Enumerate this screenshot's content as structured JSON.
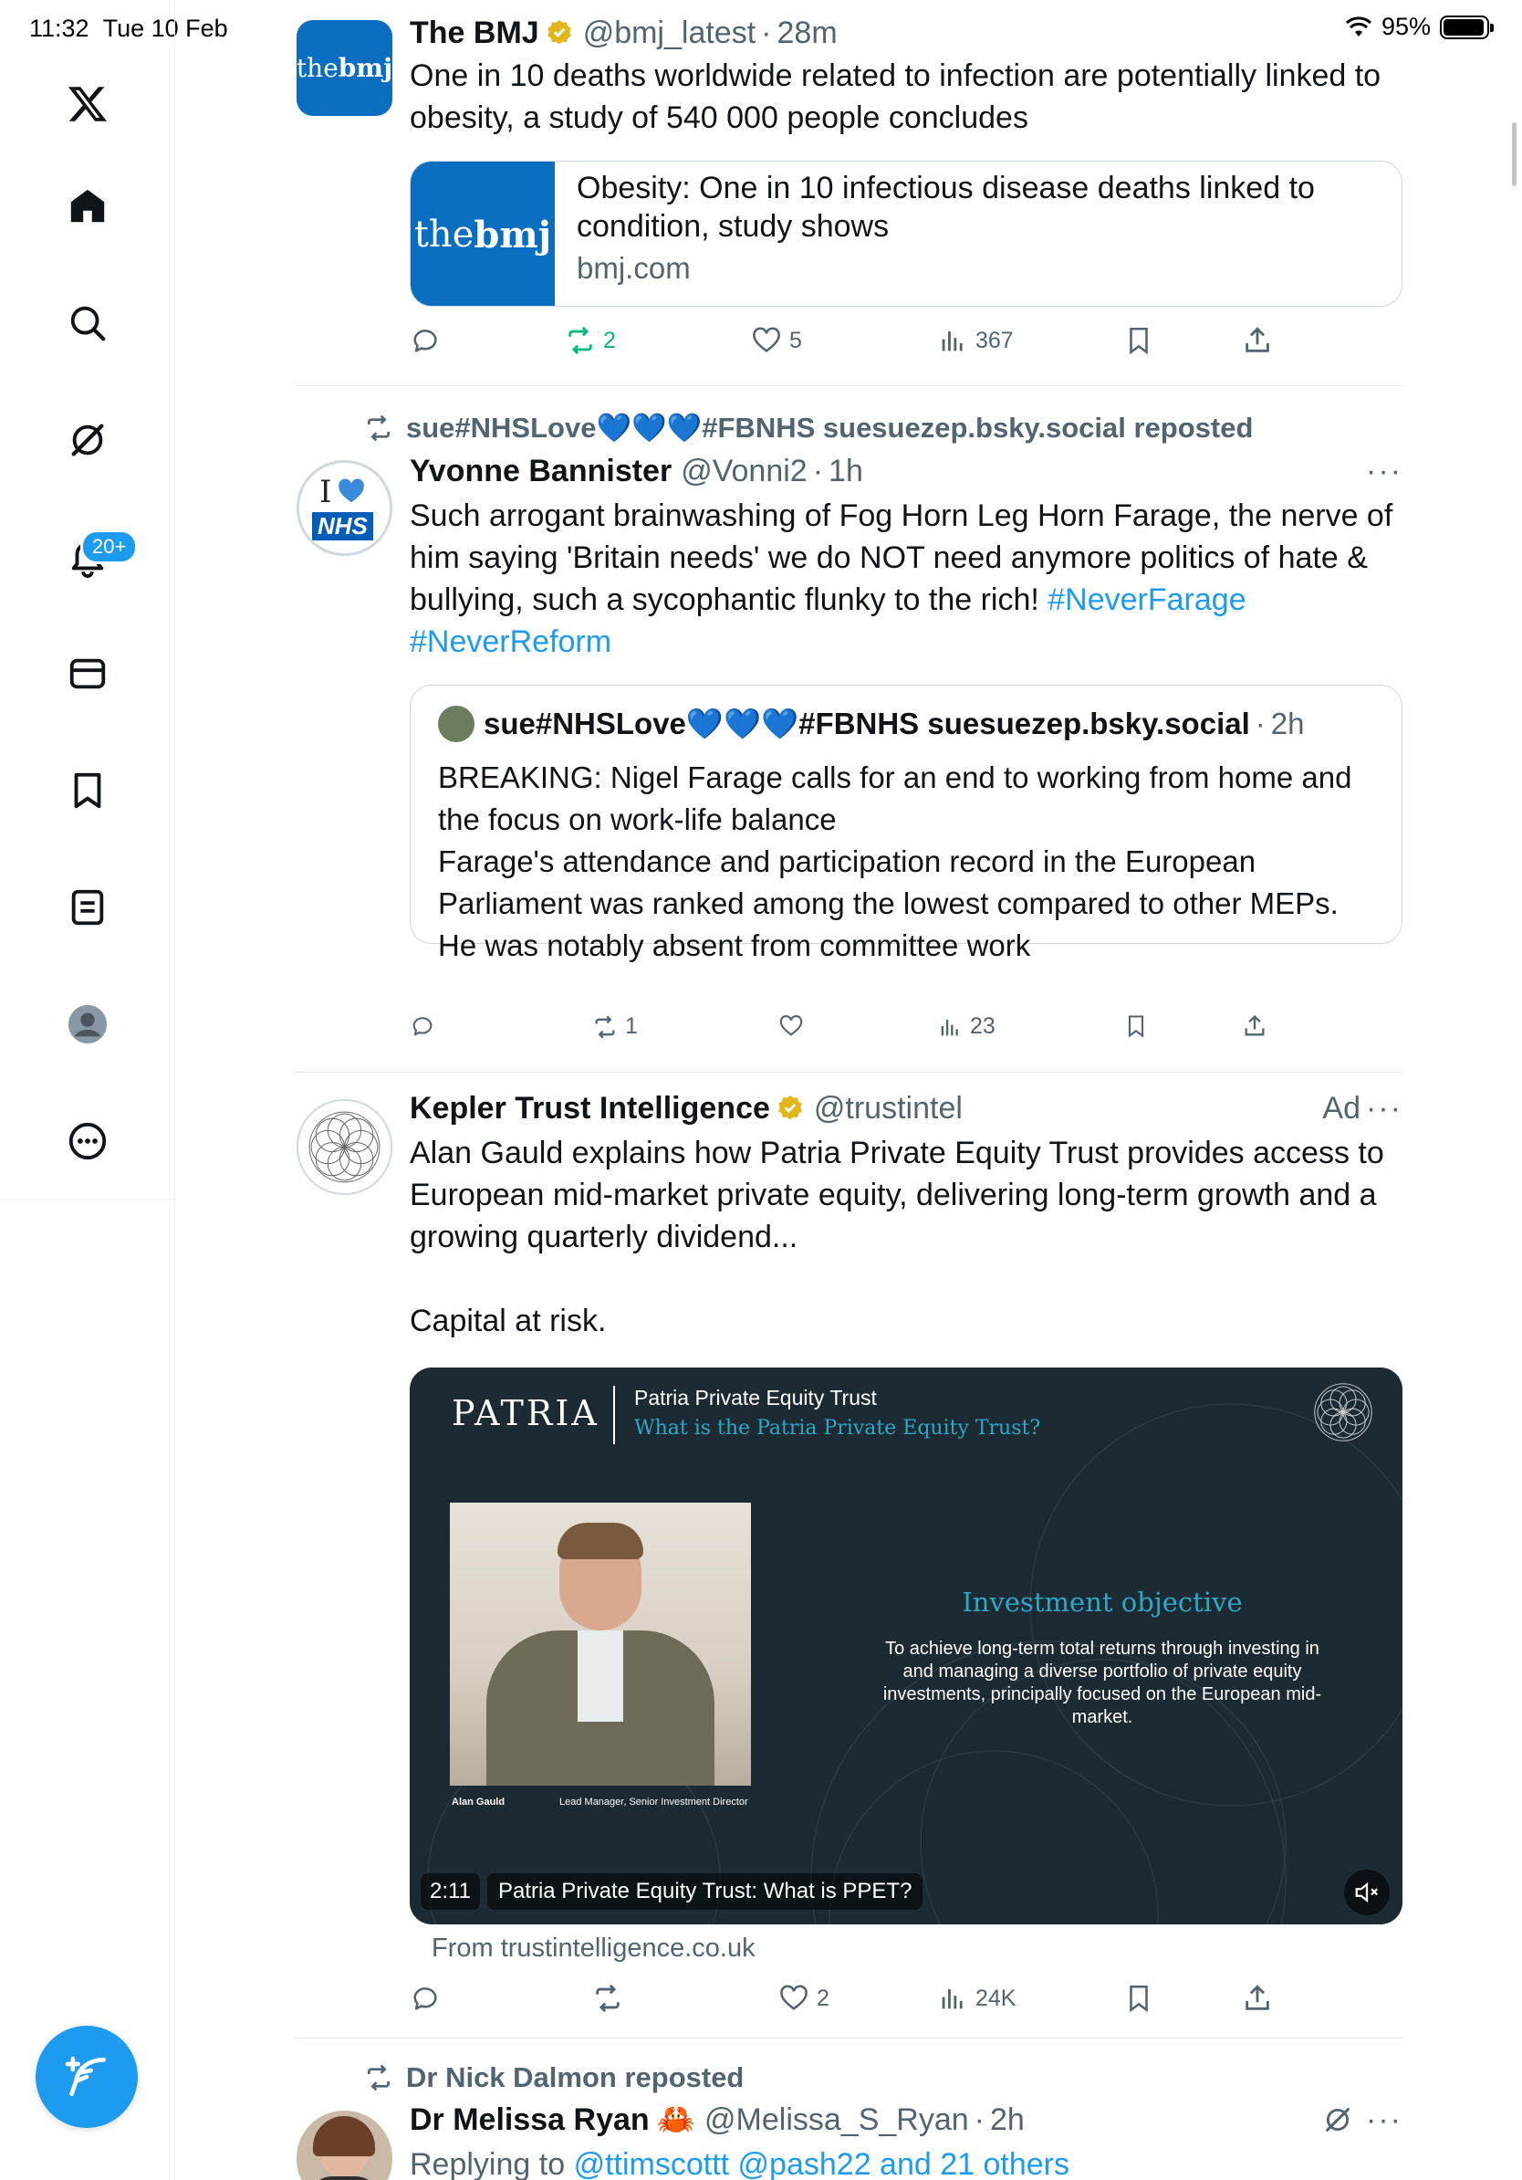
{
  "status": {
    "time": "11:32",
    "date": "Tue 10 Feb",
    "battery": "95%",
    "battery_level": 0.95
  },
  "nav": {
    "notification_badge": "20+"
  },
  "tweets": [
    {
      "name": "The BMJ",
      "handle": "@bmj_latest",
      "time": "28m",
      "avatar_text": "the",
      "avatar_text_bold": "bmj",
      "text": "One in 10 deaths worldwide related to infection are potentially linked to obesity, a study of 540 000 people concludes",
      "card": {
        "title": "Obesity: One in 10 infectious disease deaths linked to condition, study shows",
        "domain": "bmj.com"
      },
      "stats": {
        "replies": "",
        "reposts": "2",
        "likes": "5",
        "views": "367"
      }
    },
    {
      "repost_by": "sue#NHSLove💙💙💙#FBNHS suesuezep.bsky.social reposted",
      "name": "Yvonne Bannister",
      "handle": "@Vonni2",
      "time": "1h",
      "avatar_top": "I",
      "avatar_nhs": "NHS",
      "more": "···",
      "text": "Such arrogant brainwashing of Fog Horn Leg Horn Farage, the nerve of him saying 'Britain needs' we do NOT need anymore politics of hate & bullying, such a sycophantic flunky to the rich!",
      "hashtag1": "#NeverFarage",
      "hashtag2": "#NeverReform",
      "quote": {
        "name": "sue#NHSLove💙💙💙#FBNHS suesuezep.bsky.social",
        "time": "2h",
        "line1": "BREAKING: Nigel Farage calls for an end to working from home and the focus on work-life balance",
        "line2": "Farage's attendance and participation record in the European Parliament was ranked among the lowest compared to other MEPs. He was notably absent from committee work"
      },
      "stats": {
        "replies": "",
        "reposts": "1",
        "likes": "",
        "views": "23"
      }
    },
    {
      "name": "Kepler Trust Intelligence",
      "handle": "@trustintel",
      "ad_label": "Ad",
      "more": "···",
      "text": "Alan Gauld explains how Patria Private Equity Trust provides access to European mid-market private equity, delivering long-term growth and a growing quarterly dividend...",
      "text2": "Capital at risk.",
      "video": {
        "brand": "PATRIA",
        "header_title": "Patria Private Equity Trust",
        "header_subtitle": "What is the Patria Private Equity Trust?",
        "objective_title": "Investment objective",
        "objective_text": "To achieve long-term total returns through investing in and managing a diverse portfolio of private equity investments, principally focused on the European mid-market.",
        "person_name": "Alan Gauld",
        "person_role": "Lead Manager, Senior Investment Director",
        "duration": "2:11",
        "caption": "Patria Private Equity Trust: What is PPET?"
      },
      "from": "From trustintelligence.co.uk",
      "stats": {
        "replies": "",
        "reposts": "",
        "likes": "2",
        "views": "24K"
      }
    },
    {
      "repost_by": "Dr Nick Dalmon reposted",
      "name": "Dr Melissa Ryan",
      "emoji": "🦀",
      "handle": "@Melissa_S_Ryan",
      "time": "2h",
      "more": "···",
      "replying_prefix": "Replying to",
      "replying_to": "@ttimscottt @pash22 and 21 others"
    }
  ]
}
